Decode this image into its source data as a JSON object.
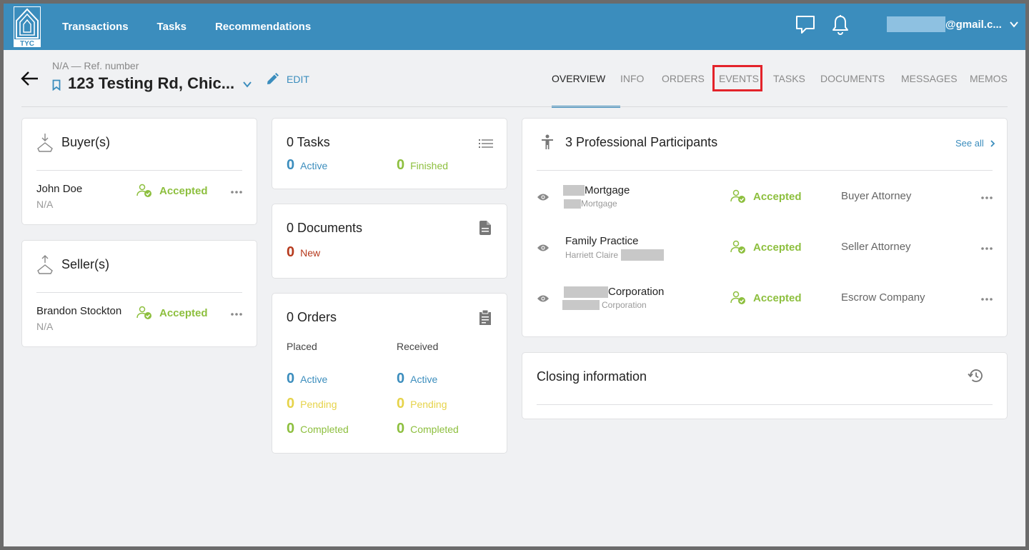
{
  "nav": {
    "items": [
      "Transactions",
      "Tasks",
      "Recommendations"
    ],
    "logo_text": "TYC",
    "user_email_suffix": "@gmail.c..."
  },
  "header": {
    "ref": "N/A — Ref. number",
    "address": "123 Testing Rd, Chic...",
    "edit_label": "EDIT",
    "tabs": [
      "OVERVIEW",
      "INFO",
      "ORDERS",
      "EVENTS",
      "TASKS",
      "DOCUMENTS",
      "MESSAGES",
      "MEMOS"
    ]
  },
  "buyers": {
    "title": "Buyer(s)",
    "name": "John Doe",
    "sub": "N/A",
    "status": "Accepted"
  },
  "sellers": {
    "title": "Seller(s)",
    "name": "Brandon Stockton",
    "sub": "N/A",
    "status": "Accepted"
  },
  "tasks_card": {
    "title": "0 Tasks",
    "active_num": "0",
    "active_label": "Active",
    "finished_num": "0",
    "finished_label": "Finished"
  },
  "documents_card": {
    "title": "0 Documents",
    "new_num": "0",
    "new_label": "New"
  },
  "orders_card": {
    "title": "0 Orders",
    "placed": "Placed",
    "received": "Received",
    "active_num": "0",
    "active_label": "Active",
    "pending_num": "0",
    "pending_label": "Pending",
    "completed_num": "0",
    "completed_label": "Completed"
  },
  "participants": {
    "title": "3 Professional Participants",
    "see_all": "See all",
    "rows": [
      {
        "name": "Mortgage",
        "sub": "Mortgage",
        "status": "Accepted",
        "role": "Buyer Attorney"
      },
      {
        "name": "Family Practice",
        "sub": "Harriett Claire",
        "status": "Accepted",
        "role": "Seller Attorney"
      },
      {
        "name": "Corporation",
        "sub": "Corporation",
        "status": "Accepted",
        "role": "Escrow Company"
      }
    ]
  },
  "closing": {
    "title": "Closing information"
  },
  "colors": {
    "topbar": "#3b8dbd",
    "accent_blue": "#3b8dbd",
    "accepted_green": "#8dbf3e",
    "pending_yellow": "#e6d34a",
    "new_red": "#b63a1d",
    "highlight_red": "#e3232a"
  }
}
